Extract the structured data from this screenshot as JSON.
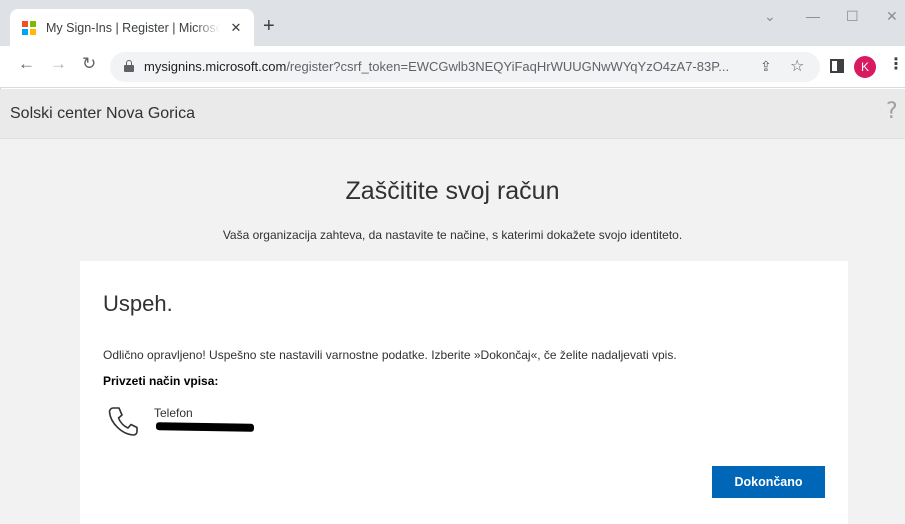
{
  "browser": {
    "tab_title": "My Sign-Ins | Register | Microsoft",
    "tab_close": "✕",
    "new_tab": "+",
    "minimize": "—",
    "restore": "☐",
    "close": "✕",
    "back": "←",
    "forward": "→",
    "reload": "↻",
    "url_host": "mysignins.microsoft.com",
    "url_path": "/register?csrf_token=EWCGwlb3NEQYiFaqHrWUUGNwWYqYzO4zA7-83P...",
    "share_icon": "⇪",
    "star_icon": "☆",
    "profile_initial": "K",
    "menu": "⋮",
    "profile_color": "#d81b60",
    "ms_logo_colors": [
      "#f25022",
      "#7fba00",
      "#00a4ef",
      "#ffb900"
    ]
  },
  "org": {
    "name": "Solski center Nova Gorica",
    "help": "?"
  },
  "main": {
    "heading": "Zaščitite svoj račun",
    "subtitle": "Vaša organizacija zahteva, da nastavite te načine, s katerimi dokažete svojo identiteto."
  },
  "card": {
    "title": "Uspeh.",
    "message": "Odlično opravljeno! Uspešno ste nastavili varnostne podatke. Izberite »Dokončaj«, če želite nadaljevati vpis.",
    "default_method_label": "Privzeti način vpisa:",
    "method": {
      "icon": "phone-icon",
      "name": "Telefon"
    },
    "done_button": "Dokončano",
    "accent_color": "#0067b8"
  }
}
